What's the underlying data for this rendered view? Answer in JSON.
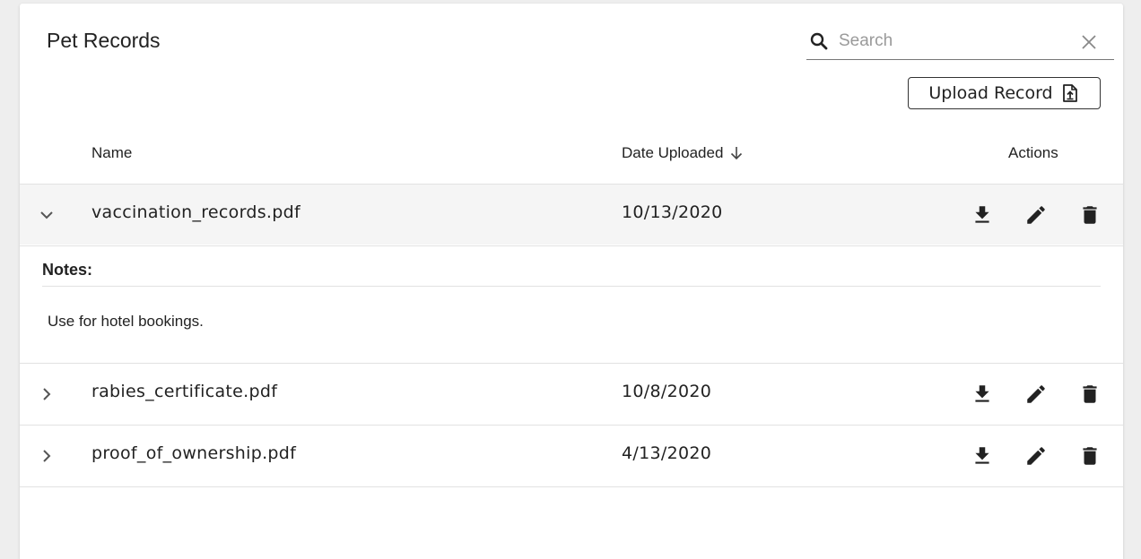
{
  "page": {
    "title": "Pet Records"
  },
  "search": {
    "placeholder": "Search",
    "value": ""
  },
  "toolbar": {
    "upload_label": "Upload Record"
  },
  "table": {
    "columns": {
      "name": "Name",
      "date": "Date Uploaded",
      "actions": "Actions"
    },
    "sort": {
      "column": "Date Uploaded",
      "direction": "descending"
    },
    "rows": [
      {
        "name": "vaccination_records.pdf",
        "date": "10/13/2020",
        "expanded": true,
        "notes_label": "Notes:",
        "notes": "Use for hotel bookings."
      },
      {
        "name": "rabies_certificate.pdf",
        "date": "10/8/2020",
        "expanded": false
      },
      {
        "name": "proof_of_ownership.pdf",
        "date": "4/13/2020",
        "expanded": false
      }
    ]
  },
  "icons": {
    "search": "search-icon",
    "clear": "close-icon",
    "upload": "file-upload-icon",
    "sort": "arrow-down-icon",
    "expand": "chevron-icon",
    "download": "download-icon",
    "edit": "pencil-icon",
    "delete": "trash-icon"
  },
  "colors": {
    "background": "#eeeeee",
    "card": "#ffffff",
    "expanded_row": "#f5f5f5",
    "text": "#222222"
  }
}
